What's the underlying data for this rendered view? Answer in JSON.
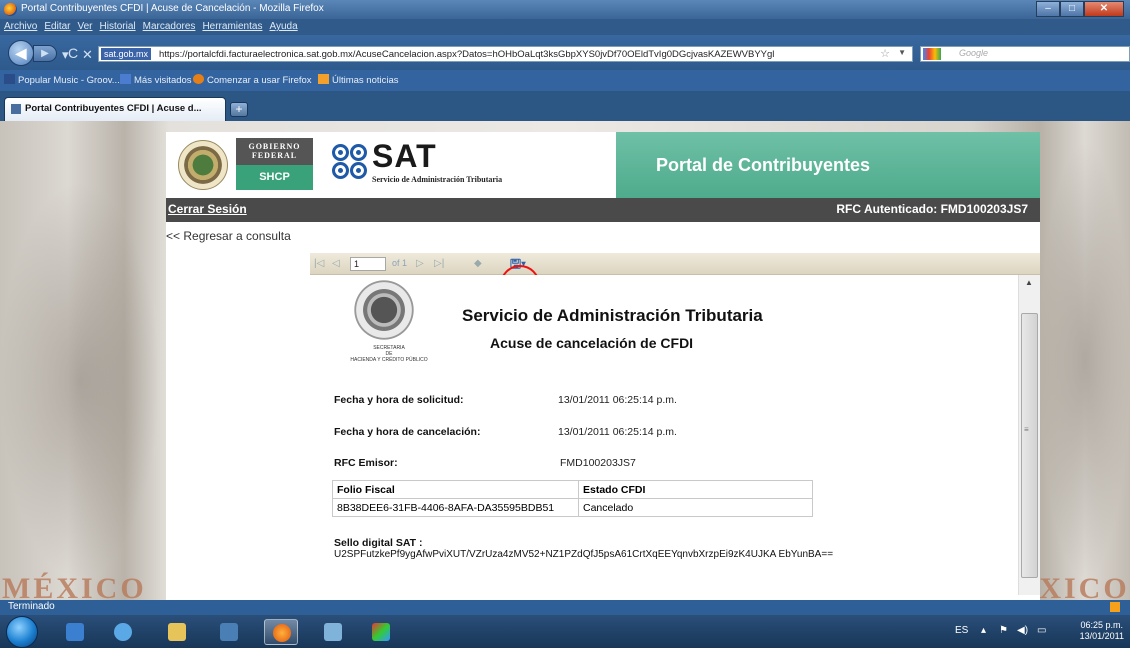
{
  "window": {
    "title": "Portal Contribuyentes CFDI | Acuse de Cancelación - Mozilla Firefox"
  },
  "menu": [
    "Archivo",
    "Editar",
    "Ver",
    "Historial",
    "Marcadores",
    "Herramientas",
    "Ayuda"
  ],
  "nav": {
    "site_badge": "sat.gob.mx",
    "url": "https://portalcfdi.facturaelectronica.sat.gob.mx/AcuseCancelacion.aspx?Datos=hOHbOaLqt3ksGbpXYS0jvDf70OEldTvIg0DGcjvasKAZEWVBYYgl",
    "search_placeholder": "Google"
  },
  "bookmarks": [
    "Popular Music - Groov...",
    "Más visitados",
    "Comenzar a usar Firefox",
    "Últimas noticias"
  ],
  "tab": {
    "label": "Portal Contribuyentes CFDI | Acuse d..."
  },
  "header": {
    "gobierno": "GOBIERNO FEDERAL",
    "shcp": "SHCP",
    "sat_word": "SAT",
    "sat_sub": "Servicio de Administración Tributaria",
    "portal_title": "Portal de Contribuyentes",
    "logout": "Cerrar Sesión",
    "rfc_auth": "RFC Autenticado: FMD100203JS7",
    "back_link": "<< Regresar a consulta"
  },
  "report_toolbar": {
    "page_value": "1",
    "page_of": "of 1"
  },
  "report": {
    "seal_caption_1": "SECRETARIA",
    "seal_caption_2": "DE",
    "seal_caption_3": "HACIENDA Y CRÉDITO PÚBLICO",
    "title": "Servicio de Administración Tributaria",
    "subtitle": "Acuse de cancelación de CFDI",
    "fecha_solicitud_label": "Fecha y hora de solicitud:",
    "fecha_solicitud_value": "13/01/2011 06:25:14 p.m.",
    "fecha_cancelacion_label": "Fecha  y hora de cancelación:",
    "fecha_cancelacion_value": "13/01/2011 06:25:14 p.m.",
    "rfc_label": "RFC Emisor:",
    "rfc_value": "FMD100203JS7",
    "folio_header": "Folio Fiscal",
    "estado_header": "Estado CFDI",
    "folio_value": "8B38DEE6-31FB-4406-8AFA-DA35595BDB51",
    "estado_value": "Cancelado",
    "sello_label": "Sello digital SAT :",
    "sello_value": "U2SPFutzkePf9ygAfwPviXUT/VZrUza4zMV52+NZ1PZdQfJ5psA61CrtXqEEYqnvbXrzpEi9zK4UJKA EbYunBA=="
  },
  "decor": {
    "watermark": "MÉXICO"
  },
  "status": {
    "text": "Terminado"
  },
  "tray": {
    "lang": "ES",
    "time": "06:25 p.m.",
    "date": "13/01/2011"
  },
  "colors": {
    "highlight": "#ee1111",
    "portal_green": "#4eab8c",
    "shcp_green": "#3aa27a"
  }
}
